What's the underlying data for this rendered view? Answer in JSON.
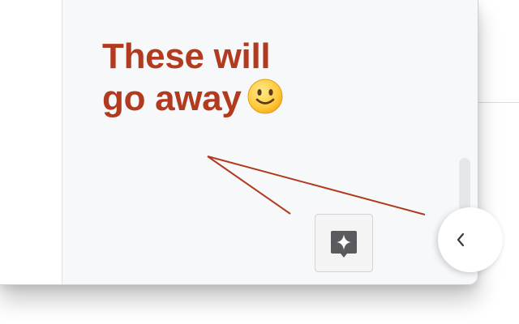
{
  "annotation": {
    "line1": "These will",
    "line2": "go away",
    "emoji_icon": "slightly-smiling-face-icon",
    "color": "#b23a1f"
  },
  "ai_button": {
    "icon": "sparkle-icon"
  },
  "collapse_button": {
    "icon": "chevron-left-icon"
  },
  "colors": {
    "pane_background": "#f7f8fa",
    "annotation_red": "#b23a1f",
    "button_icon": "#5a5a5e"
  }
}
